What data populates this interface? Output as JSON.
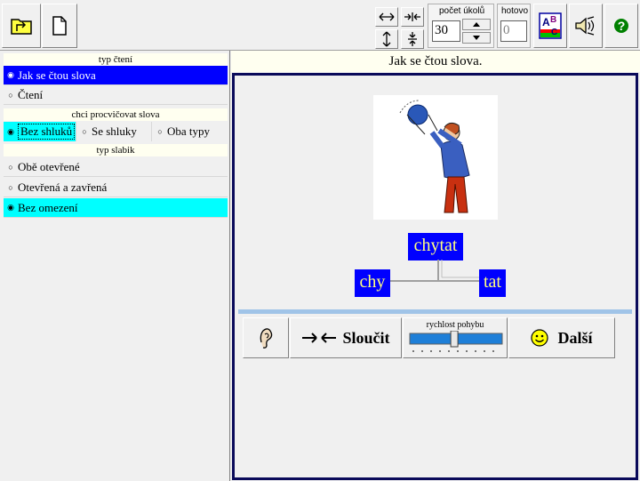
{
  "toolbar": {
    "task_count_label": "počet úkolů",
    "task_count_value": "30",
    "done_label": "hotovo",
    "done_value": "0",
    "abc_letters": [
      "A",
      "B",
      "C"
    ]
  },
  "left": {
    "reading_type": {
      "header": "typ čtení",
      "options": [
        {
          "label": "Jak se čtou slova",
          "selected": true
        },
        {
          "label": "Čtení",
          "selected": false
        }
      ]
    },
    "practice": {
      "header": "chci procvičovat slova",
      "options": [
        {
          "label": "Bez shluků",
          "selected": true
        },
        {
          "label": "Se shluky",
          "selected": false
        },
        {
          "label": "Oba typy",
          "selected": false
        }
      ]
    },
    "syllable_type": {
      "header": "typ slabik",
      "options": [
        {
          "label": "Obě otevřené",
          "selected": false
        },
        {
          "label": "Otevřená a zavřená",
          "selected": false
        },
        {
          "label": "Bez omezení",
          "selected": true
        }
      ]
    }
  },
  "main": {
    "title": "Jak se čtou slova.",
    "word_full": "chytat",
    "syllable_1": "chy",
    "syllable_2": "tat",
    "merge_label": "Sloučit",
    "speed_label": "rychlost pohybu",
    "speed_level": 0.48,
    "next_label": "Další"
  },
  "colors": {
    "selected_blue": "#0000ff",
    "selected_cyan": "#00ffff",
    "word_text": "#ffff80",
    "frame_border": "#0a0a5a"
  }
}
